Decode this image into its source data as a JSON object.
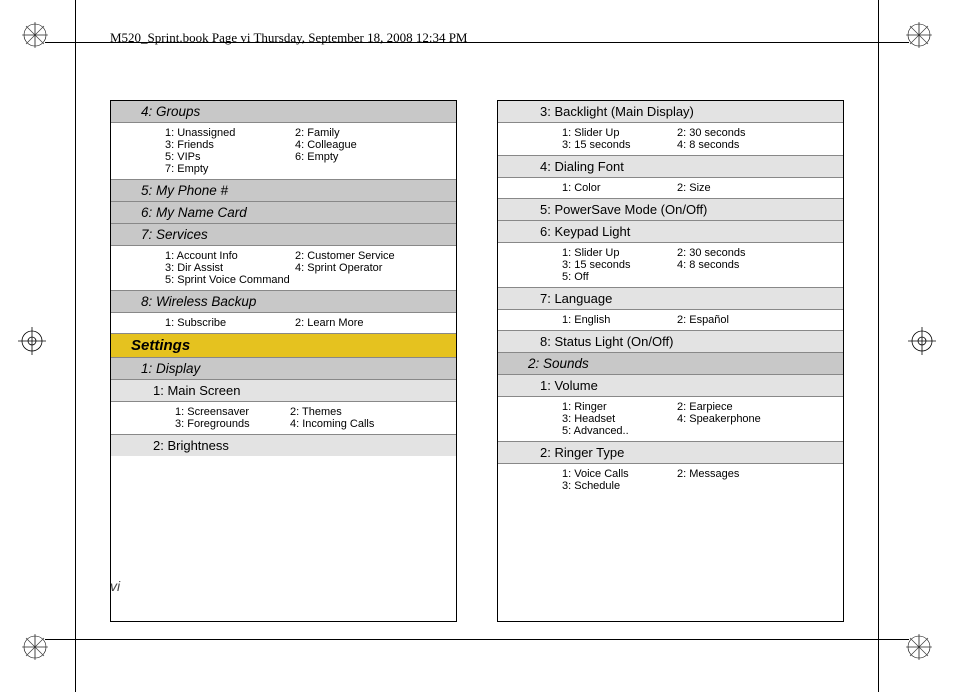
{
  "header_line": "M520_Sprint.book  Page vi  Thursday, September 18, 2008  12:34 PM",
  "page_number": "vi",
  "left": {
    "groups_hdr": "4: Groups",
    "groups_opts": [
      [
        "1: Unassigned",
        "2: Family"
      ],
      [
        "3: Friends",
        "4: Colleague"
      ],
      [
        "5: VIPs",
        "6: Empty"
      ],
      [
        "7: Empty",
        ""
      ]
    ],
    "myphone_hdr": "5: My Phone #",
    "myname_hdr": "6: My Name Card",
    "services_hdr": "7: Services",
    "services_opts": [
      [
        "1: Account Info",
        "2: Customer Service"
      ],
      [
        "3: Dir Assist",
        "4: Sprint Operator"
      ],
      [
        "5: Sprint Voice Command",
        ""
      ]
    ],
    "wireless_hdr": "8: Wireless Backup",
    "wireless_opts": [
      [
        "1: Subscribe",
        "2: Learn More"
      ]
    ],
    "settings_hdr": "Settings",
    "display_hdr": "1: Display",
    "mainscreen_hdr": "1: Main Screen",
    "mainscreen_opts": [
      [
        "1: Screensaver",
        "2: Themes"
      ],
      [
        "3: Foregrounds",
        "4: Incoming Calls"
      ]
    ],
    "brightness_hdr": "2: Brightness"
  },
  "right": {
    "backlight_hdr": "3: Backlight (Main Display)",
    "backlight_opts": [
      [
        "1: Slider Up",
        "2: 30 seconds"
      ],
      [
        "3: 15 seconds",
        "4: 8 seconds"
      ]
    ],
    "dialfont_hdr": "4: Dialing Font",
    "dialfont_opts": [
      [
        "1: Color",
        "2: Size"
      ]
    ],
    "powersave_hdr": "5: PowerSave Mode (On/Off)",
    "keypadlight_hdr": "6: Keypad Light",
    "keypadlight_opts": [
      [
        "1: Slider Up",
        "2: 30 seconds"
      ],
      [
        "3: 15 seconds",
        "4: 8 seconds"
      ],
      [
        "5: Off",
        ""
      ]
    ],
    "language_hdr": "7: Language",
    "language_opts": [
      [
        "1: English",
        "2: Español"
      ]
    ],
    "statuslight_hdr": "8: Status Light (On/Off)",
    "sounds_hdr": "2: Sounds",
    "volume_hdr": "1: Volume",
    "volume_opts": [
      [
        "1: Ringer",
        "2: Earpiece"
      ],
      [
        "3: Headset",
        "4: Speakerphone"
      ],
      [
        "5: Advanced..",
        ""
      ]
    ],
    "ringertype_hdr": "2: Ringer Type",
    "ringertype_opts": [
      [
        "1: Voice Calls",
        "2: Messages"
      ],
      [
        "3: Schedule",
        ""
      ]
    ]
  }
}
